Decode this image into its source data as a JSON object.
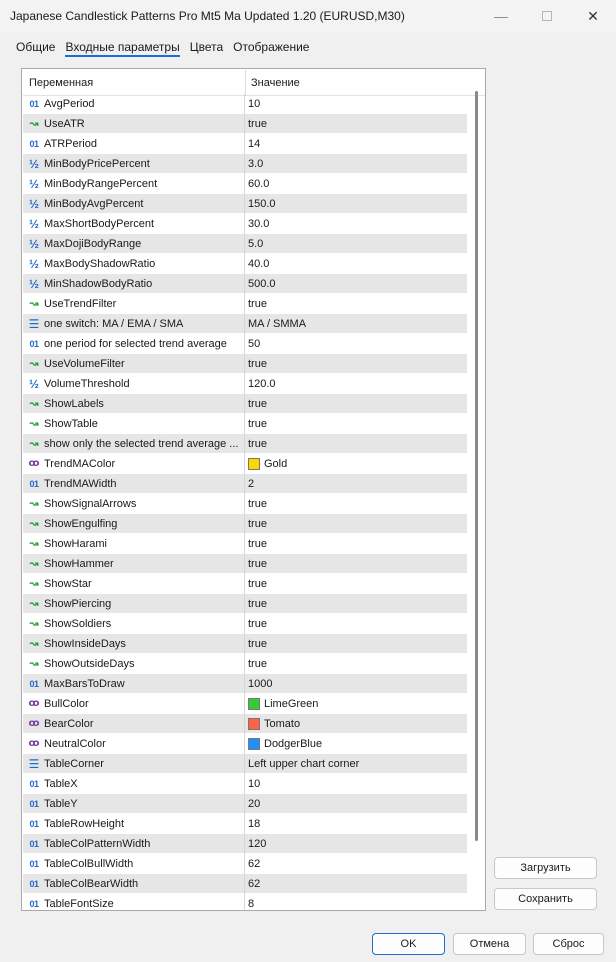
{
  "window": {
    "title": "Japanese Candlestick Patterns Pro Mt5 Ma Updated 1.20 (EURUSD,M30)"
  },
  "tabs": [
    {
      "label": "Общие",
      "active": false
    },
    {
      "label": "Входные параметры",
      "active": true
    },
    {
      "label": "Цвета",
      "active": false
    },
    {
      "label": "Отображение",
      "active": false
    }
  ],
  "columns": {
    "variable": "Переменная",
    "value": "Значение"
  },
  "icons": {
    "int": "01",
    "double": "½",
    "bool": "↝",
    "color": "ꝏ",
    "enum": "☰"
  },
  "rows": [
    {
      "type": "int",
      "name": "AvgPeriod",
      "value": "10"
    },
    {
      "type": "bool",
      "name": "UseATR",
      "value": "true"
    },
    {
      "type": "int",
      "name": "ATRPeriod",
      "value": "14"
    },
    {
      "type": "double",
      "name": "MinBodyPricePercent",
      "value": "3.0"
    },
    {
      "type": "double",
      "name": "MinBodyRangePercent",
      "value": "60.0"
    },
    {
      "type": "double",
      "name": "MinBodyAvgPercent",
      "value": "150.0"
    },
    {
      "type": "double",
      "name": "MaxShortBodyPercent",
      "value": "30.0"
    },
    {
      "type": "double",
      "name": "MaxDojiBodyRange",
      "value": "5.0"
    },
    {
      "type": "double",
      "name": "MaxBodyShadowRatio",
      "value": "40.0"
    },
    {
      "type": "double",
      "name": "MinShadowBodyRatio",
      "value": "500.0"
    },
    {
      "type": "bool",
      "name": "UseTrendFilter",
      "value": "true"
    },
    {
      "type": "enum",
      "name": "one switch: MA / EMA / SMA",
      "value": "MA / SMMA"
    },
    {
      "type": "int",
      "name": "one period for selected trend average",
      "value": "50"
    },
    {
      "type": "bool",
      "name": "UseVolumeFilter",
      "value": "true"
    },
    {
      "type": "double",
      "name": "VolumeThreshold",
      "value": "120.0"
    },
    {
      "type": "bool",
      "name": "ShowLabels",
      "value": "true"
    },
    {
      "type": "bool",
      "name": "ShowTable",
      "value": "true"
    },
    {
      "type": "bool",
      "name": "show only the selected trend average ...",
      "value": "true"
    },
    {
      "type": "color",
      "name": "TrendMAColor",
      "value": "Gold",
      "swatch": "#ffd700"
    },
    {
      "type": "int",
      "name": "TrendMAWidth",
      "value": "2"
    },
    {
      "type": "bool",
      "name": "ShowSignalArrows",
      "value": "true"
    },
    {
      "type": "bool",
      "name": "ShowEngulfing",
      "value": "true"
    },
    {
      "type": "bool",
      "name": "ShowHarami",
      "value": "true"
    },
    {
      "type": "bool",
      "name": "ShowHammer",
      "value": "true"
    },
    {
      "type": "bool",
      "name": "ShowStar",
      "value": "true"
    },
    {
      "type": "bool",
      "name": "ShowPiercing",
      "value": "true"
    },
    {
      "type": "bool",
      "name": "ShowSoldiers",
      "value": "true"
    },
    {
      "type": "bool",
      "name": "ShowInsideDays",
      "value": "true"
    },
    {
      "type": "bool",
      "name": "ShowOutsideDays",
      "value": "true"
    },
    {
      "type": "int",
      "name": "MaxBarsToDraw",
      "value": "1000"
    },
    {
      "type": "color",
      "name": "BullColor",
      "value": "LimeGreen",
      "swatch": "#32cd32"
    },
    {
      "type": "color",
      "name": "BearColor",
      "value": "Tomato",
      "swatch": "#ff6347"
    },
    {
      "type": "color",
      "name": "NeutralColor",
      "value": "DodgerBlue",
      "swatch": "#1e90ff"
    },
    {
      "type": "enum",
      "name": "TableCorner",
      "value": "Left upper chart corner"
    },
    {
      "type": "int",
      "name": "TableX",
      "value": "10"
    },
    {
      "type": "int",
      "name": "TableY",
      "value": "20"
    },
    {
      "type": "int",
      "name": "TableRowHeight",
      "value": "18"
    },
    {
      "type": "int",
      "name": "TableColPatternWidth",
      "value": "120"
    },
    {
      "type": "int",
      "name": "TableColBullWidth",
      "value": "62"
    },
    {
      "type": "int",
      "name": "TableColBearWidth",
      "value": "62"
    },
    {
      "type": "int",
      "name": "TableFontSize",
      "value": "8"
    }
  ],
  "side_buttons": {
    "load": "Загрузить",
    "save": "Сохранить"
  },
  "footer_buttons": {
    "ok": "OK",
    "cancel": "Отмена",
    "reset": "Сброс"
  },
  "colors": {
    "accent": "#1a6fd6",
    "row_alt": "#e6e6e6"
  }
}
